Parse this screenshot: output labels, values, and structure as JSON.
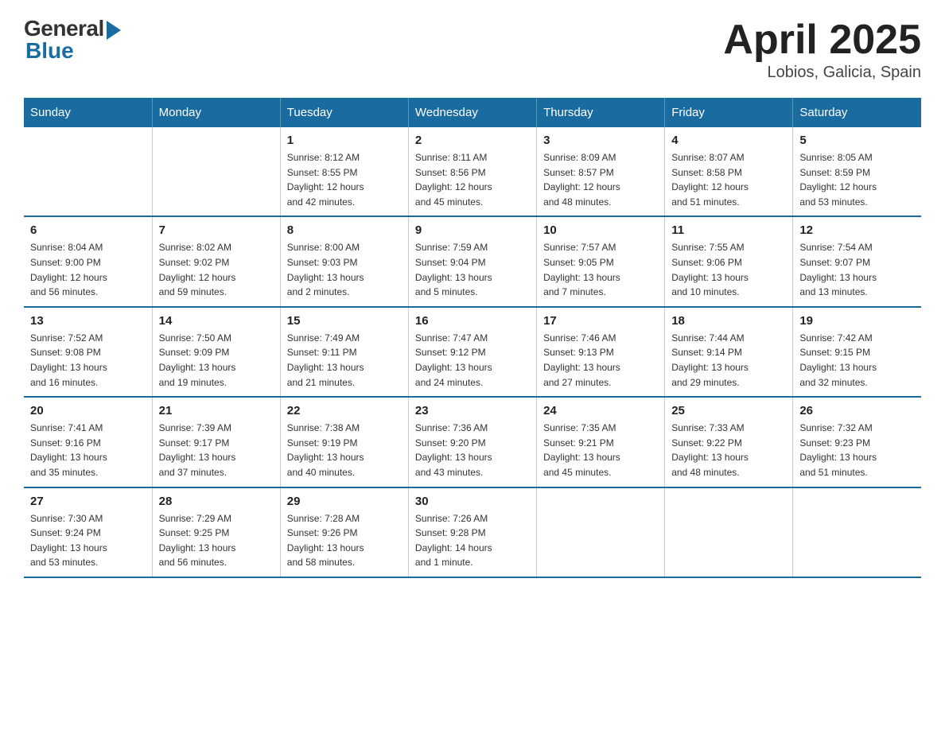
{
  "logo": {
    "general": "General",
    "blue": "Blue"
  },
  "title": "April 2025",
  "subtitle": "Lobios, Galicia, Spain",
  "weekdays": [
    "Sunday",
    "Monday",
    "Tuesday",
    "Wednesday",
    "Thursday",
    "Friday",
    "Saturday"
  ],
  "weeks": [
    [
      {
        "day": "",
        "info": ""
      },
      {
        "day": "",
        "info": ""
      },
      {
        "day": "1",
        "info": "Sunrise: 8:12 AM\nSunset: 8:55 PM\nDaylight: 12 hours\nand 42 minutes."
      },
      {
        "day": "2",
        "info": "Sunrise: 8:11 AM\nSunset: 8:56 PM\nDaylight: 12 hours\nand 45 minutes."
      },
      {
        "day": "3",
        "info": "Sunrise: 8:09 AM\nSunset: 8:57 PM\nDaylight: 12 hours\nand 48 minutes."
      },
      {
        "day": "4",
        "info": "Sunrise: 8:07 AM\nSunset: 8:58 PM\nDaylight: 12 hours\nand 51 minutes."
      },
      {
        "day": "5",
        "info": "Sunrise: 8:05 AM\nSunset: 8:59 PM\nDaylight: 12 hours\nand 53 minutes."
      }
    ],
    [
      {
        "day": "6",
        "info": "Sunrise: 8:04 AM\nSunset: 9:00 PM\nDaylight: 12 hours\nand 56 minutes."
      },
      {
        "day": "7",
        "info": "Sunrise: 8:02 AM\nSunset: 9:02 PM\nDaylight: 12 hours\nand 59 minutes."
      },
      {
        "day": "8",
        "info": "Sunrise: 8:00 AM\nSunset: 9:03 PM\nDaylight: 13 hours\nand 2 minutes."
      },
      {
        "day": "9",
        "info": "Sunrise: 7:59 AM\nSunset: 9:04 PM\nDaylight: 13 hours\nand 5 minutes."
      },
      {
        "day": "10",
        "info": "Sunrise: 7:57 AM\nSunset: 9:05 PM\nDaylight: 13 hours\nand 7 minutes."
      },
      {
        "day": "11",
        "info": "Sunrise: 7:55 AM\nSunset: 9:06 PM\nDaylight: 13 hours\nand 10 minutes."
      },
      {
        "day": "12",
        "info": "Sunrise: 7:54 AM\nSunset: 9:07 PM\nDaylight: 13 hours\nand 13 minutes."
      }
    ],
    [
      {
        "day": "13",
        "info": "Sunrise: 7:52 AM\nSunset: 9:08 PM\nDaylight: 13 hours\nand 16 minutes."
      },
      {
        "day": "14",
        "info": "Sunrise: 7:50 AM\nSunset: 9:09 PM\nDaylight: 13 hours\nand 19 minutes."
      },
      {
        "day": "15",
        "info": "Sunrise: 7:49 AM\nSunset: 9:11 PM\nDaylight: 13 hours\nand 21 minutes."
      },
      {
        "day": "16",
        "info": "Sunrise: 7:47 AM\nSunset: 9:12 PM\nDaylight: 13 hours\nand 24 minutes."
      },
      {
        "day": "17",
        "info": "Sunrise: 7:46 AM\nSunset: 9:13 PM\nDaylight: 13 hours\nand 27 minutes."
      },
      {
        "day": "18",
        "info": "Sunrise: 7:44 AM\nSunset: 9:14 PM\nDaylight: 13 hours\nand 29 minutes."
      },
      {
        "day": "19",
        "info": "Sunrise: 7:42 AM\nSunset: 9:15 PM\nDaylight: 13 hours\nand 32 minutes."
      }
    ],
    [
      {
        "day": "20",
        "info": "Sunrise: 7:41 AM\nSunset: 9:16 PM\nDaylight: 13 hours\nand 35 minutes."
      },
      {
        "day": "21",
        "info": "Sunrise: 7:39 AM\nSunset: 9:17 PM\nDaylight: 13 hours\nand 37 minutes."
      },
      {
        "day": "22",
        "info": "Sunrise: 7:38 AM\nSunset: 9:19 PM\nDaylight: 13 hours\nand 40 minutes."
      },
      {
        "day": "23",
        "info": "Sunrise: 7:36 AM\nSunset: 9:20 PM\nDaylight: 13 hours\nand 43 minutes."
      },
      {
        "day": "24",
        "info": "Sunrise: 7:35 AM\nSunset: 9:21 PM\nDaylight: 13 hours\nand 45 minutes."
      },
      {
        "day": "25",
        "info": "Sunrise: 7:33 AM\nSunset: 9:22 PM\nDaylight: 13 hours\nand 48 minutes."
      },
      {
        "day": "26",
        "info": "Sunrise: 7:32 AM\nSunset: 9:23 PM\nDaylight: 13 hours\nand 51 minutes."
      }
    ],
    [
      {
        "day": "27",
        "info": "Sunrise: 7:30 AM\nSunset: 9:24 PM\nDaylight: 13 hours\nand 53 minutes."
      },
      {
        "day": "28",
        "info": "Sunrise: 7:29 AM\nSunset: 9:25 PM\nDaylight: 13 hours\nand 56 minutes."
      },
      {
        "day": "29",
        "info": "Sunrise: 7:28 AM\nSunset: 9:26 PM\nDaylight: 13 hours\nand 58 minutes."
      },
      {
        "day": "30",
        "info": "Sunrise: 7:26 AM\nSunset: 9:28 PM\nDaylight: 14 hours\nand 1 minute."
      },
      {
        "day": "",
        "info": ""
      },
      {
        "day": "",
        "info": ""
      },
      {
        "day": "",
        "info": ""
      }
    ]
  ]
}
